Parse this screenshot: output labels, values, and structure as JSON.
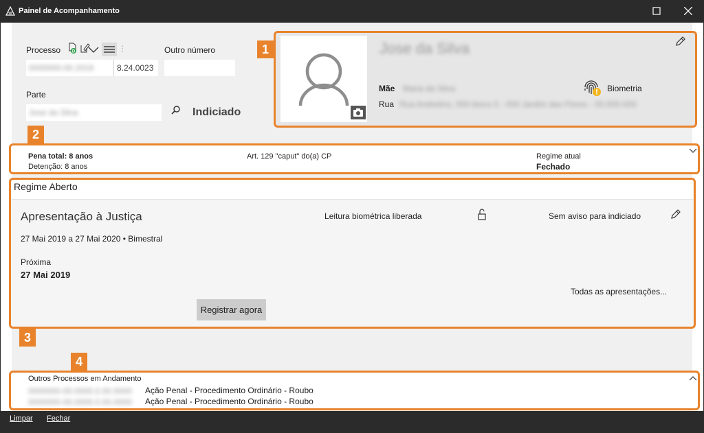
{
  "window": {
    "title": "Painel de Acompanhamento",
    "icons": [
      "app-logo-icon",
      "maximize-icon",
      "close-icon"
    ]
  },
  "search": {
    "processo_label": "Processo",
    "processo_value_blurred": "0000000-00.2019",
    "processo_suffix": "8.24.0023",
    "outro_numero_label": "Outro número",
    "outro_numero_value": "",
    "parte_label": "Parte",
    "parte_value_blurred": "Jose da Silva",
    "indiciado_label": "Indiciado"
  },
  "person": {
    "name_blurred": "Jose da Silva",
    "mae_label": "Mãe",
    "mae_value_blurred": "Maria da Silva",
    "rua_label": "Rua",
    "rua_value_blurred": "Rua Andrelino, 000 bloco 0 - 000 Jardim das Flores - 00.000-000",
    "biometria_label": "Biometria"
  },
  "badges": [
    "1",
    "2",
    "3",
    "4"
  ],
  "pena": {
    "total": "Pena total: 8 anos",
    "detencao": "Detenção: 8 anos",
    "artigo": "Art. 129 \"caput\" do(a) CP",
    "regime_label": "Regime atual",
    "regime_value": "Fechado"
  },
  "regime_aberto": {
    "title": "Regime Aberto",
    "apresentacao_title": "Apresentação à Justiça",
    "leitura": "Leitura biométrica liberada",
    "aviso": "Sem aviso para indiciado",
    "periodo": "27 Mai 2019 a 27 Mai 2020 • Bimestral",
    "proxima_label": "Próxima",
    "proxima_value": "27 Mai 2019",
    "todas_link": "Todas as apresentações...",
    "registrar_button": "Registrar agora"
  },
  "outros_processos": {
    "title": "Outros Processos em Andamento",
    "rows": [
      {
        "numero_blurred": "0000000-00.0000.0.00.0000",
        "descricao": "Ação Penal - Procedimento Ordinário - Roubo"
      },
      {
        "numero_blurred": "0000000-00.0000.0.00.0000",
        "descricao": "Ação Penal - Procedimento Ordinário - Roubo"
      }
    ]
  },
  "footer": {
    "limpar": "Limpar",
    "fechar": "Fechar"
  },
  "colors": {
    "annotation": "#e8832c",
    "titlebar": "#2b2b2b",
    "panel": "#f0f0f0"
  }
}
